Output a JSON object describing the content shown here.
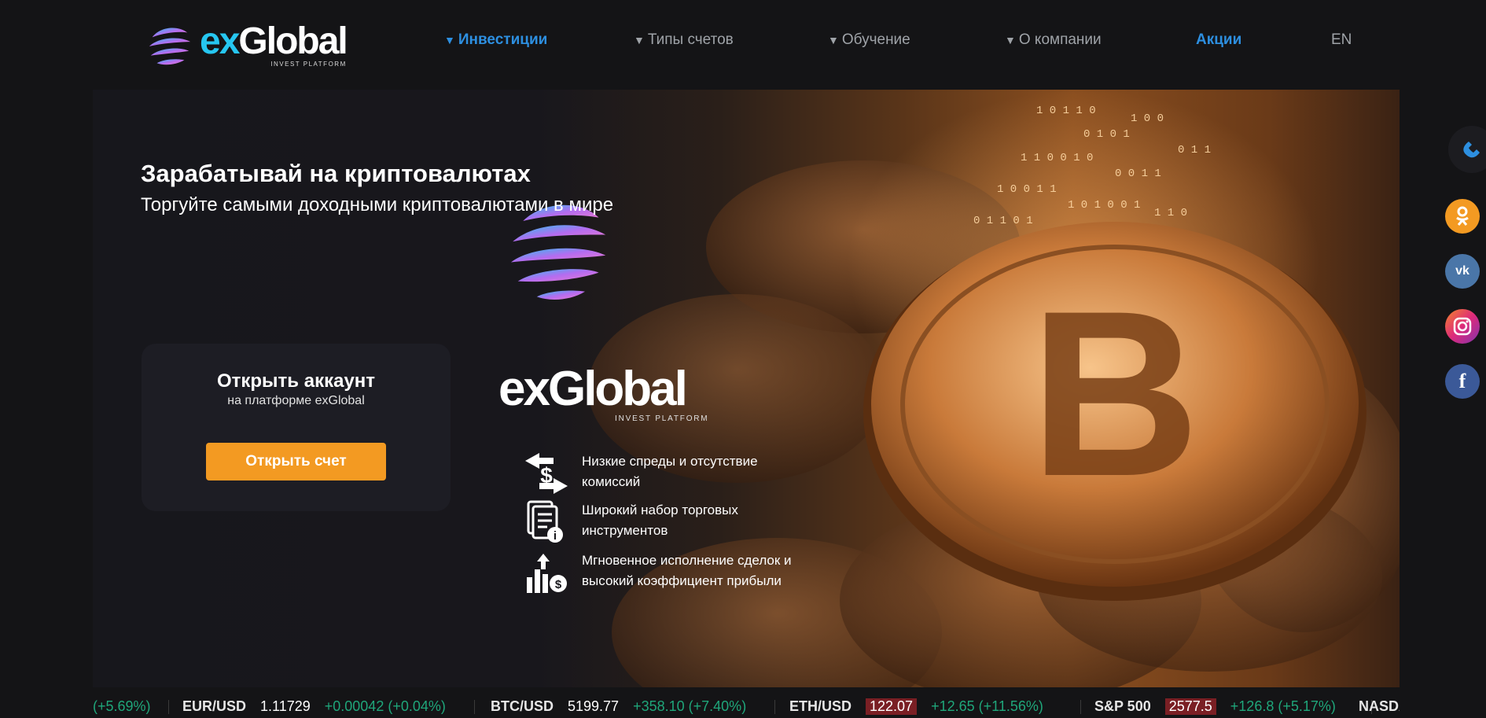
{
  "header": {
    "logo": {
      "ex": "ex",
      "global": "Global",
      "sub": "INVEST PLATFORM"
    },
    "nav": [
      {
        "label": "Инвестиции",
        "dropdown": true,
        "active": true
      },
      {
        "label": "Типы счетов",
        "dropdown": true,
        "active": false
      },
      {
        "label": "Обучение",
        "dropdown": true,
        "active": false
      },
      {
        "label": "О компании",
        "dropdown": true,
        "active": false
      },
      {
        "label": "Акции",
        "dropdown": false,
        "active": true
      },
      {
        "label": "EN",
        "dropdown": false,
        "active": false
      }
    ]
  },
  "hero": {
    "title": "Зарабатывай на криптовалютах",
    "subtitle": "Торгуйте самыми доходными криптовалютами в мире",
    "card": {
      "title": "Открыть аккаунт",
      "subtitle": "на платформе exGlobal",
      "button": "Открыть счет"
    },
    "brand": {
      "name": "exGlobal",
      "sub": "INVEST PLATFORM"
    },
    "features": [
      {
        "icon": "exchange-dollar-icon",
        "text": "Низкие спреды и отсутствие комиссий"
      },
      {
        "icon": "documents-info-icon",
        "text": "Широкий набор торговых инструментов"
      },
      {
        "icon": "growth-chart-dollar-icon",
        "text": "Мгновенное исполнение сделок и высокий коэффициент прибыли"
      }
    ]
  },
  "ticker": [
    {
      "symbol": "",
      "price": "",
      "change": "(+5.69%)",
      "down": false
    },
    {
      "symbol": "EUR/USD",
      "price": "1.11729",
      "change": "+0.00042 (+0.04%)",
      "down": false
    },
    {
      "symbol": "BTC/USD",
      "price": "5199.77",
      "change": "+358.10 (+7.40%)",
      "down": false
    },
    {
      "symbol": "ETH/USD",
      "price": "122.07",
      "change": "+12.65 (+11.56%)",
      "down": true
    },
    {
      "symbol": "S&P 500",
      "price": "2577.5",
      "change": "+126.8 (+5.17%)",
      "down": true
    },
    {
      "symbol": "NASDA",
      "price": "",
      "change": "",
      "down": false
    }
  ],
  "social": [
    {
      "name": "phone-icon",
      "color": "#2d8fe0"
    },
    {
      "name": "odnoklassniki-icon",
      "color": "#f39a22"
    },
    {
      "name": "vk-icon",
      "color": "#4a76a8"
    },
    {
      "name": "instagram-icon",
      "color": "#c13584"
    },
    {
      "name": "facebook-icon",
      "color": "#3b5998"
    }
  ],
  "colors": {
    "accent_blue": "#2d8fe0",
    "orange": "#f39a22",
    "positive": "#1fa67a",
    "negative_bg": "#7a1f24"
  }
}
